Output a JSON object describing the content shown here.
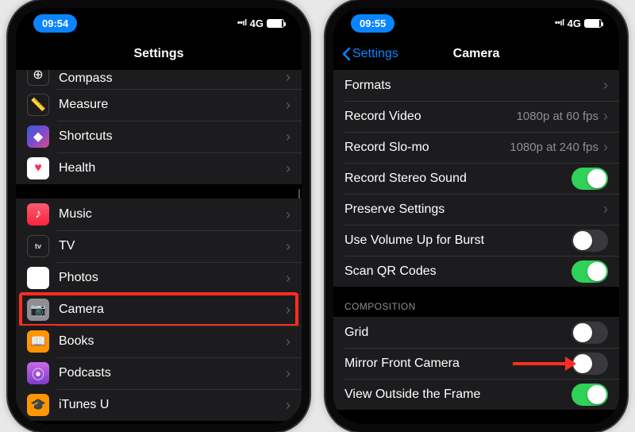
{
  "left": {
    "status_time": "09:54",
    "network": "4G",
    "signal_bars": "••ıl",
    "title": "Settings",
    "groups": [
      {
        "rows": [
          {
            "icon": "compass-icon",
            "icon_class": "ic-compass",
            "glyph": "⊕",
            "label": "Compass"
          },
          {
            "icon": "measure-icon",
            "icon_class": "ic-measure",
            "glyph": "📏",
            "label": "Measure"
          },
          {
            "icon": "shortcuts-icon",
            "icon_class": "ic-shortcuts",
            "glyph": "◆",
            "label": "Shortcuts"
          },
          {
            "icon": "health-icon",
            "icon_class": "ic-health",
            "glyph": "♥",
            "label": "Health"
          }
        ]
      },
      {
        "rows": [
          {
            "icon": "music-icon",
            "icon_class": "ic-music",
            "glyph": "♪",
            "label": "Music"
          },
          {
            "icon": "tv-icon",
            "icon_class": "ic-tv",
            "glyph": "tv",
            "label": "TV"
          },
          {
            "icon": "photos-icon",
            "icon_class": "ic-photos",
            "glyph": "✿",
            "label": "Photos"
          },
          {
            "icon": "camera-icon",
            "icon_class": "ic-camera",
            "glyph": "📷",
            "label": "Camera",
            "highlight": true
          },
          {
            "icon": "books-icon",
            "icon_class": "ic-books",
            "glyph": "📖",
            "label": "Books"
          },
          {
            "icon": "podcasts-icon",
            "icon_class": "ic-podcasts",
            "glyph": "⦿",
            "label": "Podcasts"
          },
          {
            "icon": "itunesu-icon",
            "icon_class": "ic-itunesu",
            "glyph": "🎓",
            "label": "iTunes U"
          }
        ]
      }
    ]
  },
  "right": {
    "status_time": "09:55",
    "network": "4G",
    "signal_bars": "••ıl",
    "back_label": "Settings",
    "title": "Camera",
    "groups": [
      {
        "header": null,
        "rows": [
          {
            "label": "Formats",
            "type": "nav"
          },
          {
            "label": "Record Video",
            "type": "nav",
            "value": "1080p at 60 fps"
          },
          {
            "label": "Record Slo-mo",
            "type": "nav",
            "value": "1080p at 240 fps"
          },
          {
            "label": "Record Stereo Sound",
            "type": "toggle",
            "on": true
          },
          {
            "label": "Preserve Settings",
            "type": "nav"
          },
          {
            "label": "Use Volume Up for Burst",
            "type": "toggle",
            "on": false
          },
          {
            "label": "Scan QR Codes",
            "type": "toggle",
            "on": true
          }
        ]
      },
      {
        "header": "COMPOSITION",
        "rows": [
          {
            "label": "Grid",
            "type": "toggle",
            "on": false
          },
          {
            "label": "Mirror Front Camera",
            "type": "toggle",
            "on": false,
            "arrow": true
          },
          {
            "label": "View Outside the Frame",
            "type": "toggle",
            "on": true
          }
        ]
      }
    ]
  }
}
